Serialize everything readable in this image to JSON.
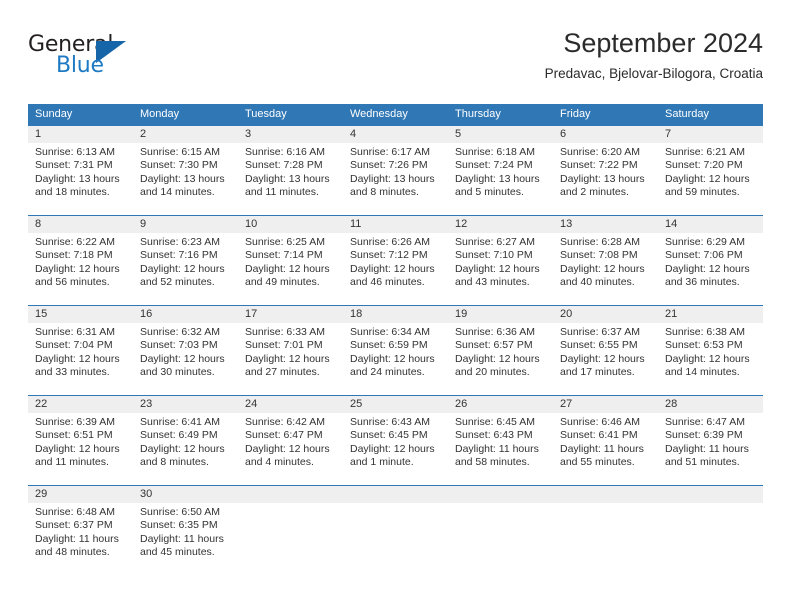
{
  "logo": {
    "primary_text": "General",
    "secondary_text": "Blue",
    "primary_color": "#231f20",
    "secondary_color": "#1f7ac4",
    "triangle_color": "#1565a8"
  },
  "header": {
    "title": "September 2024",
    "subtitle": "Predavac, Bjelovar-Bilogora, Croatia"
  },
  "theme": {
    "header_bar_color": "#3077b5",
    "daynum_band_color": "#efefef",
    "text_color": "#333333"
  },
  "weekdays": [
    "Sunday",
    "Monday",
    "Tuesday",
    "Wednesday",
    "Thursday",
    "Friday",
    "Saturday"
  ],
  "weeks": [
    [
      {
        "day": "1",
        "sunrise": "Sunrise: 6:13 AM",
        "sunset": "Sunset: 7:31 PM",
        "daylight1": "Daylight: 13 hours",
        "daylight2": "and 18 minutes."
      },
      {
        "day": "2",
        "sunrise": "Sunrise: 6:15 AM",
        "sunset": "Sunset: 7:30 PM",
        "daylight1": "Daylight: 13 hours",
        "daylight2": "and 14 minutes."
      },
      {
        "day": "3",
        "sunrise": "Sunrise: 6:16 AM",
        "sunset": "Sunset: 7:28 PM",
        "daylight1": "Daylight: 13 hours",
        "daylight2": "and 11 minutes."
      },
      {
        "day": "4",
        "sunrise": "Sunrise: 6:17 AM",
        "sunset": "Sunset: 7:26 PM",
        "daylight1": "Daylight: 13 hours",
        "daylight2": "and 8 minutes."
      },
      {
        "day": "5",
        "sunrise": "Sunrise: 6:18 AM",
        "sunset": "Sunset: 7:24 PM",
        "daylight1": "Daylight: 13 hours",
        "daylight2": "and 5 minutes."
      },
      {
        "day": "6",
        "sunrise": "Sunrise: 6:20 AM",
        "sunset": "Sunset: 7:22 PM",
        "daylight1": "Daylight: 13 hours",
        "daylight2": "and 2 minutes."
      },
      {
        "day": "7",
        "sunrise": "Sunrise: 6:21 AM",
        "sunset": "Sunset: 7:20 PM",
        "daylight1": "Daylight: 12 hours",
        "daylight2": "and 59 minutes."
      }
    ],
    [
      {
        "day": "8",
        "sunrise": "Sunrise: 6:22 AM",
        "sunset": "Sunset: 7:18 PM",
        "daylight1": "Daylight: 12 hours",
        "daylight2": "and 56 minutes."
      },
      {
        "day": "9",
        "sunrise": "Sunrise: 6:23 AM",
        "sunset": "Sunset: 7:16 PM",
        "daylight1": "Daylight: 12 hours",
        "daylight2": "and 52 minutes."
      },
      {
        "day": "10",
        "sunrise": "Sunrise: 6:25 AM",
        "sunset": "Sunset: 7:14 PM",
        "daylight1": "Daylight: 12 hours",
        "daylight2": "and 49 minutes."
      },
      {
        "day": "11",
        "sunrise": "Sunrise: 6:26 AM",
        "sunset": "Sunset: 7:12 PM",
        "daylight1": "Daylight: 12 hours",
        "daylight2": "and 46 minutes."
      },
      {
        "day": "12",
        "sunrise": "Sunrise: 6:27 AM",
        "sunset": "Sunset: 7:10 PM",
        "daylight1": "Daylight: 12 hours",
        "daylight2": "and 43 minutes."
      },
      {
        "day": "13",
        "sunrise": "Sunrise: 6:28 AM",
        "sunset": "Sunset: 7:08 PM",
        "daylight1": "Daylight: 12 hours",
        "daylight2": "and 40 minutes."
      },
      {
        "day": "14",
        "sunrise": "Sunrise: 6:29 AM",
        "sunset": "Sunset: 7:06 PM",
        "daylight1": "Daylight: 12 hours",
        "daylight2": "and 36 minutes."
      }
    ],
    [
      {
        "day": "15",
        "sunrise": "Sunrise: 6:31 AM",
        "sunset": "Sunset: 7:04 PM",
        "daylight1": "Daylight: 12 hours",
        "daylight2": "and 33 minutes."
      },
      {
        "day": "16",
        "sunrise": "Sunrise: 6:32 AM",
        "sunset": "Sunset: 7:03 PM",
        "daylight1": "Daylight: 12 hours",
        "daylight2": "and 30 minutes."
      },
      {
        "day": "17",
        "sunrise": "Sunrise: 6:33 AM",
        "sunset": "Sunset: 7:01 PM",
        "daylight1": "Daylight: 12 hours",
        "daylight2": "and 27 minutes."
      },
      {
        "day": "18",
        "sunrise": "Sunrise: 6:34 AM",
        "sunset": "Sunset: 6:59 PM",
        "daylight1": "Daylight: 12 hours",
        "daylight2": "and 24 minutes."
      },
      {
        "day": "19",
        "sunrise": "Sunrise: 6:36 AM",
        "sunset": "Sunset: 6:57 PM",
        "daylight1": "Daylight: 12 hours",
        "daylight2": "and 20 minutes."
      },
      {
        "day": "20",
        "sunrise": "Sunrise: 6:37 AM",
        "sunset": "Sunset: 6:55 PM",
        "daylight1": "Daylight: 12 hours",
        "daylight2": "and 17 minutes."
      },
      {
        "day": "21",
        "sunrise": "Sunrise: 6:38 AM",
        "sunset": "Sunset: 6:53 PM",
        "daylight1": "Daylight: 12 hours",
        "daylight2": "and 14 minutes."
      }
    ],
    [
      {
        "day": "22",
        "sunrise": "Sunrise: 6:39 AM",
        "sunset": "Sunset: 6:51 PM",
        "daylight1": "Daylight: 12 hours",
        "daylight2": "and 11 minutes."
      },
      {
        "day": "23",
        "sunrise": "Sunrise: 6:41 AM",
        "sunset": "Sunset: 6:49 PM",
        "daylight1": "Daylight: 12 hours",
        "daylight2": "and 8 minutes."
      },
      {
        "day": "24",
        "sunrise": "Sunrise: 6:42 AM",
        "sunset": "Sunset: 6:47 PM",
        "daylight1": "Daylight: 12 hours",
        "daylight2": "and 4 minutes."
      },
      {
        "day": "25",
        "sunrise": "Sunrise: 6:43 AM",
        "sunset": "Sunset: 6:45 PM",
        "daylight1": "Daylight: 12 hours",
        "daylight2": "and 1 minute."
      },
      {
        "day": "26",
        "sunrise": "Sunrise: 6:45 AM",
        "sunset": "Sunset: 6:43 PM",
        "daylight1": "Daylight: 11 hours",
        "daylight2": "and 58 minutes."
      },
      {
        "day": "27",
        "sunrise": "Sunrise: 6:46 AM",
        "sunset": "Sunset: 6:41 PM",
        "daylight1": "Daylight: 11 hours",
        "daylight2": "and 55 minutes."
      },
      {
        "day": "28",
        "sunrise": "Sunrise: 6:47 AM",
        "sunset": "Sunset: 6:39 PM",
        "daylight1": "Daylight: 11 hours",
        "daylight2": "and 51 minutes."
      }
    ],
    [
      {
        "day": "29",
        "sunrise": "Sunrise: 6:48 AM",
        "sunset": "Sunset: 6:37 PM",
        "daylight1": "Daylight: 11 hours",
        "daylight2": "and 48 minutes."
      },
      {
        "day": "30",
        "sunrise": "Sunrise: 6:50 AM",
        "sunset": "Sunset: 6:35 PM",
        "daylight1": "Daylight: 11 hours",
        "daylight2": "and 45 minutes."
      },
      {
        "day": "",
        "sunrise": "",
        "sunset": "",
        "daylight1": "",
        "daylight2": ""
      },
      {
        "day": "",
        "sunrise": "",
        "sunset": "",
        "daylight1": "",
        "daylight2": ""
      },
      {
        "day": "",
        "sunrise": "",
        "sunset": "",
        "daylight1": "",
        "daylight2": ""
      },
      {
        "day": "",
        "sunrise": "",
        "sunset": "",
        "daylight1": "",
        "daylight2": ""
      },
      {
        "day": "",
        "sunrise": "",
        "sunset": "",
        "daylight1": "",
        "daylight2": ""
      }
    ]
  ]
}
